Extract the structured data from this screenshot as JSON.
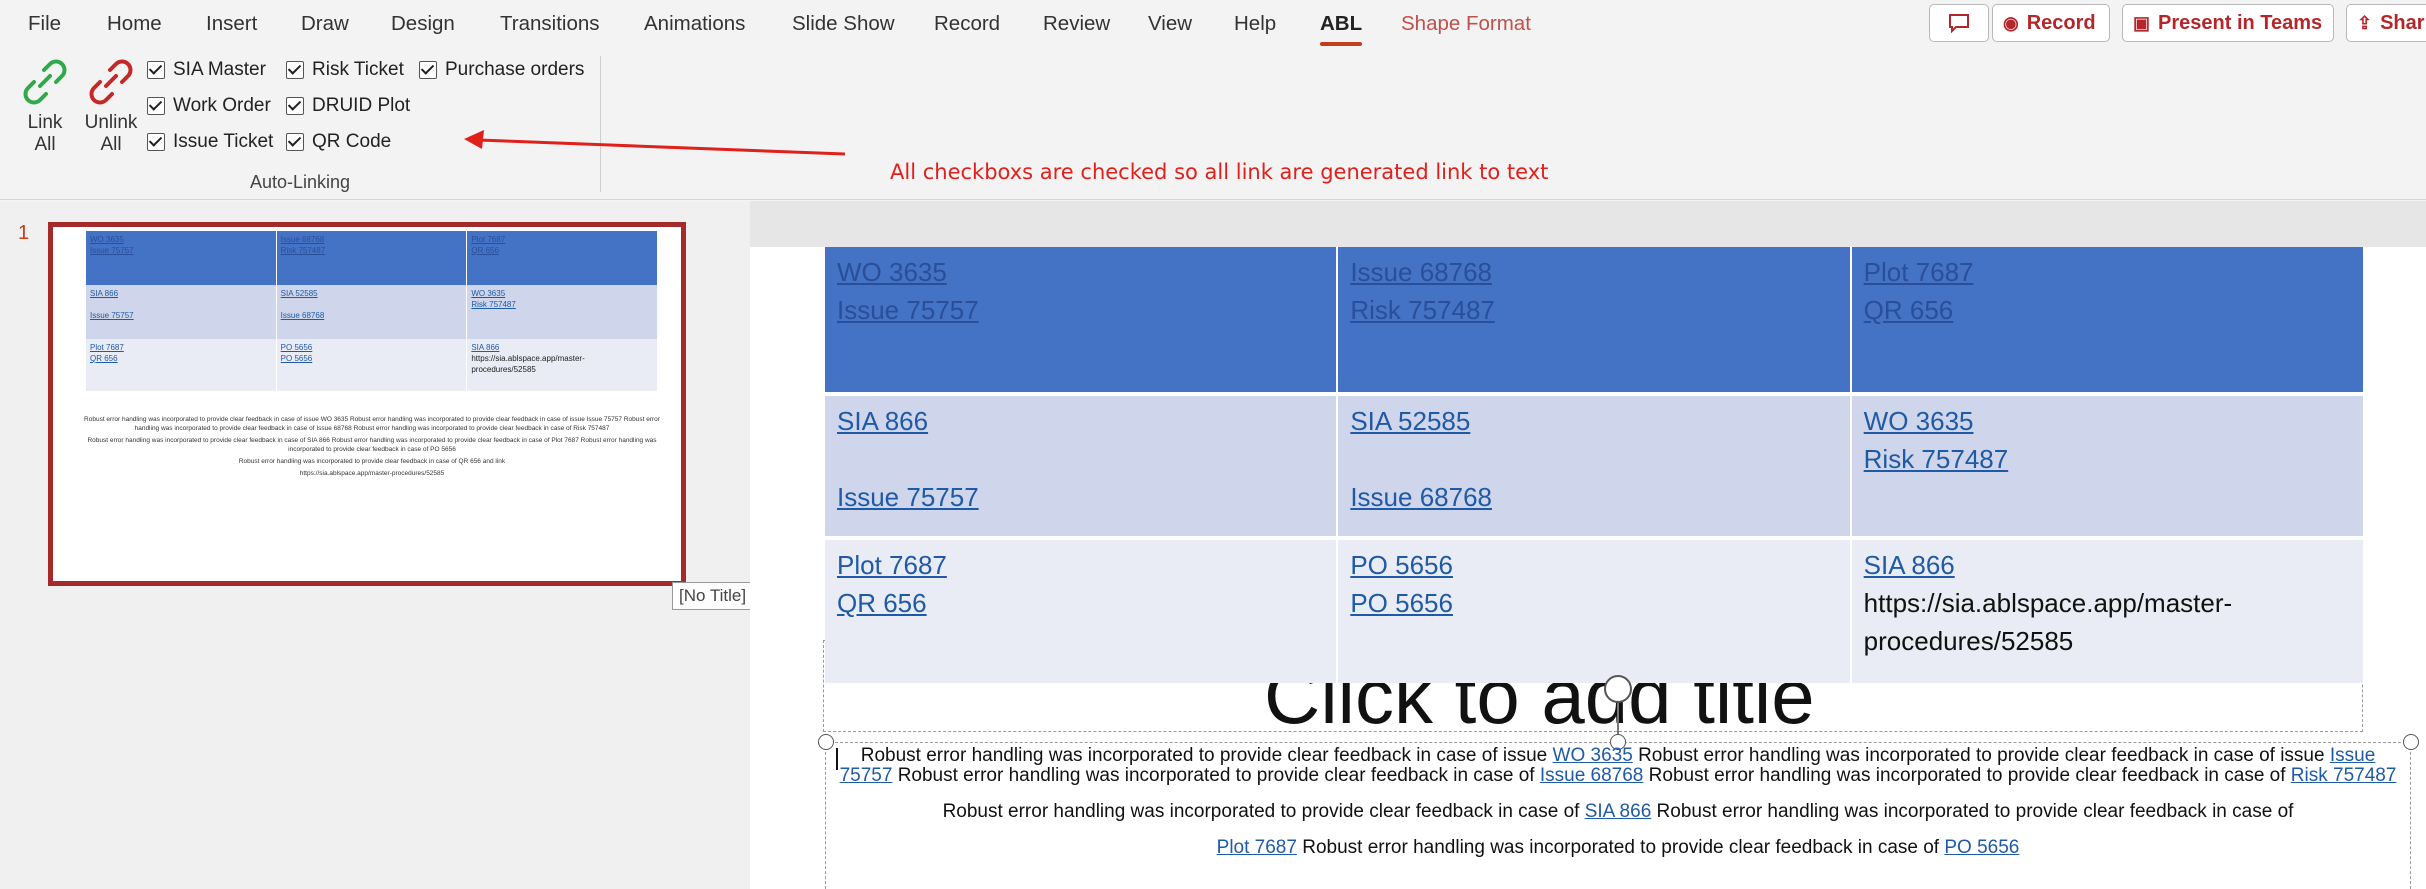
{
  "ribbon": {
    "tabs": [
      {
        "label": "File"
      },
      {
        "label": "Home"
      },
      {
        "label": "Insert"
      },
      {
        "label": "Draw"
      },
      {
        "label": "Design"
      },
      {
        "label": "Transitions"
      },
      {
        "label": "Animations"
      },
      {
        "label": "Slide Show"
      },
      {
        "label": "Record"
      },
      {
        "label": "Review"
      },
      {
        "label": "View"
      },
      {
        "label": "Help"
      },
      {
        "label": "ABL"
      },
      {
        "label": "Shape Format"
      }
    ],
    "active_tab": "ABL",
    "actions": {
      "comments_icon": "comment-icon",
      "record_label": "Record",
      "present_label": "Present in Teams",
      "share_label": "Shar"
    },
    "group": {
      "label": "Auto-Linking",
      "link_all_line1": "Link",
      "link_all_line2": "All",
      "unlink_all_line1": "Unlink",
      "unlink_all_line2": "All",
      "checkboxes": [
        {
          "label": "SIA Master",
          "checked": true
        },
        {
          "label": "Work Order",
          "checked": true
        },
        {
          "label": "Issue Ticket",
          "checked": true
        },
        {
          "label": "Risk Ticket",
          "checked": true
        },
        {
          "label": "DRUID Plot",
          "checked": true
        },
        {
          "label": "QR Code",
          "checked": true
        },
        {
          "label": "Purchase orders",
          "checked": true
        }
      ]
    }
  },
  "annotation": {
    "text": "All checkboxs are checked so all link are generated  link to text",
    "color": "#e0201b"
  },
  "thumbnails": {
    "slide_number": "1",
    "tooltip": "[No Title]"
  },
  "slide": {
    "title_placeholder": "Click to add title",
    "table": {
      "header": [
        [
          "WO 3635",
          "Issue 75757"
        ],
        [
          "Issue 68768",
          "Risk 757487"
        ],
        [
          "Plot 7687",
          "QR 656 "
        ]
      ],
      "row1": [
        [
          "SIA 866",
          "",
          "Issue 75757"
        ],
        [
          "SIA 52585",
          "",
          "Issue 68768"
        ],
        [
          "WO 3635",
          "Risk 757487"
        ]
      ],
      "row2": {
        "col1": [
          "Plot 7687",
          "QR 656"
        ],
        "col2": [
          "PO 5656",
          "PO 5656"
        ],
        "col3_link": "SIA 866",
        "col3_url_line1": "https://sia.ablspace.app/master-",
        "col3_url_line2": "procedures/52585"
      }
    },
    "body": {
      "sentence": "Robust error handling was incorporated to provide clear feedback in case of",
      "p1_a": "Robust error handling was incorporated to provide clear feedback in case of issue ",
      "p1_link1": "WO 3635",
      "p1_b": " Robust error handling was incorporated to provide clear feedback in case of issue ",
      "p1_link2": "Issue 75757",
      "p1_c": " Robust error handling was incorporated to provide clear feedback in case of ",
      "p1_link3": "Issue 68768",
      "p1_d": "Robust error handling was incorporated to provide clear feedback in case of ",
      "p1_link4": "Risk 757487",
      "p2_a": "Robust error handling was incorporated to provide clear feedback in case of ",
      "p2_link1": "SIA 866",
      "p2_b": " Robust error handling was incorporated to provide clear feedback in case of",
      "p3_link1": "Plot 7687",
      "p3_a": " Robust error handling was incorporated to provide clear feedback in case of ",
      "p3_link2": "PO 5656"
    }
  },
  "thumbnail_preview": {
    "sentence1": "Robust error handling was incorporated to provide clear feedback in case of issue WO 3635 Robust error handling was incorporated to provide clear feedback in case of issue Issue 75757 Robust error handling was incorporated to provide clear feedback in case of Issue 68768 Robust error handling was incorporated to provide clear feedback in case of Risk 757487",
    "sentence2": "Robust error handling was incorporated to provide clear feedback in case of SIA 866 Robust error handling was incorporated to provide clear feedback in case of Plot 7687 Robust error handling was incorporated to provide clear feedback in case of PO 5656",
    "sentence3": "Robust error handling was incorporated to provide clear feedback in case of QR 656 and link",
    "sentence4": "https://sia.ablspace.app/master-procedures/52585"
  }
}
